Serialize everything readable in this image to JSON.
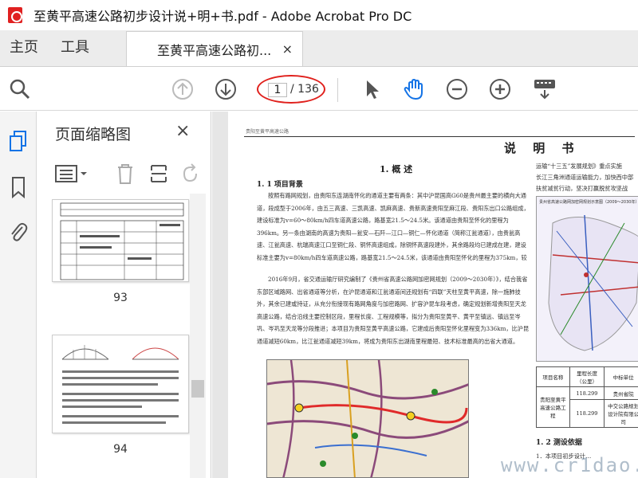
{
  "window": {
    "title": "至黄平高速公路初步设计说+明+书.pdf - Adobe Acrobat Pro DC",
    "app_icon": "acrobat-icon"
  },
  "tabs": {
    "home": "主页",
    "tools": "工具",
    "document": "至黄平高速公路初...",
    "close_glyph": "×"
  },
  "toolbar": {
    "page_current": "1",
    "page_total": "/ 136",
    "icons": [
      "search-icon",
      "page-up-icon",
      "page-down-icon",
      "select-arrow-icon",
      "hand-icon",
      "zoom-out-icon",
      "zoom-in-icon",
      "keyboard-icon"
    ],
    "accent_color": "#1473e6",
    "highlight_color": "#e0201c"
  },
  "thumbnails": {
    "title": "页面缩略图",
    "close_glyph": "×",
    "pages": [
      {
        "label": "93"
      },
      {
        "label": "94"
      }
    ]
  },
  "document": {
    "header": "贵阳至黄平高速公路",
    "main_title": "说 明 书",
    "section1": "1. 概  述",
    "sub11": "1. 1 项目背景",
    "para1": "按照有路网规划，由贵阳东连湖南怀化的通道主要有两条：其中沪昆国高G60是贵州最主要的横向大通道，段成型于2006年，由五三高速、三凯高速、凯麻高速、贵新高速贵阳至麻江段、贵阳东出口公路组成，建设标准为v=60～80km/h四车道高速公路，路基宽21.5～24.5米。该通道由贵阳至怀化的里程为396km。另一条由湖南的高速为贵阳—瓮安—石阡—江口—铜仁—怀化通道（简称江瓮通道），由贵瓮高速、江瓮高速、杭瑞高速江口至铜仁段、铜怀高速组成，除铜怀高速段建外，其余路段均已建成在建，建设标准主要为v=80km/h四车道高速公路，路基宽21.5～24.5米，该通道由贵阳至怀化的里程为375km，较沪昆通道短21km。",
    "para2": "2016年9月，省交通运输厅研究编制了《贵州省高速公路网加密网规划（2009～2030年）》，结合我省东部区域路网、出省通道等分析，在沪昆通道和江瓮通道间还规划有“四联”天柱至黄平高速，除一施肺技外，其余已建或持证，从充分衔接现有路网角度与加密路网、扩容沪昆车段考虑，确定规划新增贵阳至天龙高速公路，结合沿线主要控制区段，里程长度、工程规模等，拟分为贵阳至黄平、黄平至镇远、镇远至岑巩、岑巩至天龙等分段推进；本项目为贵阳至黄平高速公路，它建成后贵阳至怀化里程变为336km，比沪昆通道减短60km，比江瓮通道减短39km，将成为贵阳东出湖南里程最短、技术标准最高的出省大通道。",
    "right_line1": "运输“十三五”发展规划》重点实施",
    "right_line2": "长江三角洲通道运输能力，加快西中部",
    "right_line3": "扶贫减贫行动，坚决打赢脱贫攻坚战",
    "map_right_title": "贵州省高速公路网加密网规划示意图（2009～2030年）",
    "table": {
      "headers": [
        "项目名称",
        "里程长度（公里）",
        "中标单位"
      ],
      "row_name": "贵阳至黄平高速公路工程",
      "row_length_1": "118.299",
      "row_unit_1": "贵州省院",
      "row_length_2": "118.299",
      "row_unit_2": "中交公路规划设计院有限公司"
    },
    "sub13": "1. 2 测设依据",
    "right_bottom1": "1．本项目初步设计…",
    "watermark": "www.cr1dao.com"
  }
}
